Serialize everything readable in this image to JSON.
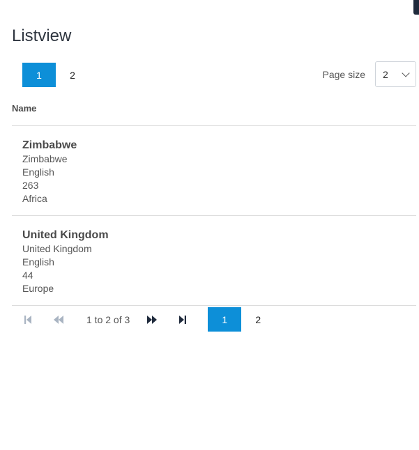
{
  "page": {
    "title": "Listview"
  },
  "top_pager": {
    "pages": [
      "1",
      "2"
    ],
    "active": "1"
  },
  "page_size": {
    "label": "Page size",
    "value": "2"
  },
  "list": {
    "column_header": "Name",
    "items": [
      {
        "title": "Zimbabwe",
        "lines": [
          "Zimbabwe",
          "English",
          "263",
          "Africa"
        ]
      },
      {
        "title": "United Kingdom",
        "lines": [
          "United Kingdom",
          "English",
          "44",
          "Europe"
        ]
      }
    ]
  },
  "bottom_pager": {
    "status": "1 to 2 of 3",
    "pages": [
      "1",
      "2"
    ],
    "active": "1",
    "icons": {
      "first": "first-page-icon",
      "previous": "previous-page-icon",
      "next": "next-page-icon",
      "last": "last-page-icon"
    },
    "colors": {
      "disabled": "#a9b4c2",
      "enabled": "#1f2a3c"
    }
  },
  "colors": {
    "accent": "#0d8fd8",
    "divider": "#dcdcdc"
  }
}
